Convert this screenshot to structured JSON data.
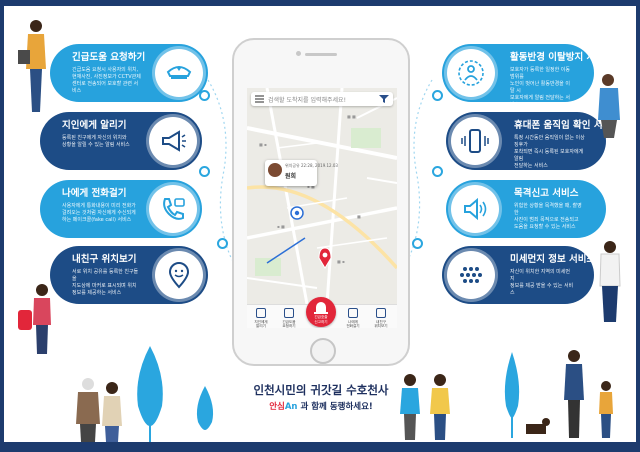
{
  "app": {
    "search_placeholder": "검색할 도착지를 입력해주세요!",
    "profile_time": "위치공유 22:28, 2019.12.03",
    "profile_name": "원희",
    "tabs": [
      {
        "label": "지인에게\n알리기",
        "icon": "share-icon"
      },
      {
        "label": "긴급도움\n요청하기",
        "icon": "shield-icon"
      },
      {
        "label": "긴급호출\n신고하기",
        "icon": "siren-icon"
      },
      {
        "label": "나에게\n전화걸기",
        "icon": "phone-icon"
      },
      {
        "label": "내친구\n위치보기",
        "icon": "location-icon"
      }
    ]
  },
  "left_features": [
    {
      "title": "긴급도움 요청하기",
      "desc": "긴급도움 요청시 사용자의 위치,\n현재사진, 사진정보가 CCTV관제\n센터로 전송되어 보호할 관련 서비스",
      "icon": "police-cap-icon",
      "color": "#27a2dd"
    },
    {
      "title": "지인에게 알리기",
      "desc": "등록된 친구에게 자신의 위치와\n상황을 알릴 수 있는 알림 서비스",
      "icon": "megaphone-icon",
      "color": "#1d4c86"
    },
    {
      "title": "나에게 전화걸기",
      "desc": "사용자에게 통화내용이 미리 전화가\n걸려오는 것처럼 자신에게 수신되게\n하는 페이크콜(fake call) 서비스",
      "icon": "phone-call-icon",
      "color": "#27a2dd"
    },
    {
      "title": "내친구 위치보기",
      "desc": "서로 위치 공유를 등록한 친구들을\n지도상에 마커로 표시되며 위치\n정보를 제공하는 서비스",
      "icon": "location-face-icon",
      "color": "#1d4c86"
    }
  ],
  "right_features": [
    {
      "title": "활동반경 이탈방지 서비스",
      "desc": "보호자가 등록한 일정한 이동범위를\n노인이 벗어난 활동반경을 이탈 시\n보호자에게 알림 전달하는 서비스",
      "icon": "radius-person-icon",
      "color": "#27a2dd"
    },
    {
      "title": "휴대폰 움직임 확인 서비스",
      "desc": "특정 시간동안 움직임이 없는 이상징후가\n포착되면 즉시 등록된 보호자에게 알림\n전달하는 서비스",
      "icon": "phone-vibrate-icon",
      "color": "#1d4c86"
    },
    {
      "title": "목격신고 서비스",
      "desc": "위험한 상황을 목격했을 때, 촬영한\n사진이 범죄 목적으로 전송되고\n도움을 요청할 수 있는 서비스",
      "icon": "speaker-icon",
      "color": "#27a2dd"
    },
    {
      "title": "미세먼지 정보 서비스",
      "desc": "자신이 위치한 지역의 미세먼지\n정보를 제공 받을 수 있는 서비스",
      "icon": "dust-dots-icon",
      "color": "#1d4c86"
    }
  ],
  "slogan": {
    "line1": "인천시민의 귀갓길 수호천사",
    "brand_a": "안심",
    "brand_b": "An",
    "line2_rest": "과 함께 동행하세요!"
  },
  "colors": {
    "light_blue": "#27a2dd",
    "dark_blue": "#1d4c86",
    "navy": "#1d2f5e",
    "sos_red": "#e2263a"
  }
}
